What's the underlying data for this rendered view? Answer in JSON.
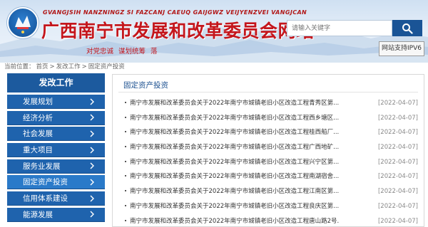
{
  "header": {
    "pinyin": "GVANGJSIH NANZNINGZ SI FAZCANJ CAEUQ GAIJGWZ VEIJYENZVEI VANGJCAN",
    "title": "广西南宁市发展和改革委员会网站",
    "slogan": "对党忠诚  谋划统筹  落",
    "search_placeholder": "请输入关键字",
    "ipv6_label": "网站支持IPV6"
  },
  "breadcrumb": {
    "prefix": "当前位置：",
    "items": [
      "首页",
      "发改工作",
      "固定资产投资"
    ],
    "separator": ">"
  },
  "sidebar": {
    "title": "发改工作",
    "items": [
      {
        "label": "发展规划"
      },
      {
        "label": "经济分析"
      },
      {
        "label": "社会发展"
      },
      {
        "label": "重大项目"
      },
      {
        "label": "服务业发展"
      },
      {
        "label": "固定资产投资"
      },
      {
        "label": "信用体系建设"
      },
      {
        "label": "能源发展"
      }
    ]
  },
  "content": {
    "title": "固定资产投资",
    "articles": [
      {
        "title": "南宁市发展和改革委员会关于2022年南宁市城镇老旧小区改造工程青秀区第...",
        "date": "[2022-04-07]"
      },
      {
        "title": "南宁市发展和改革委员会关于2022年南宁市城镇老旧小区改造工程西乡塘区...",
        "date": "[2022-04-07]"
      },
      {
        "title": "南宁市发展和改革委员会关于2022年南宁市城镇老旧小区改造工程桂西船厂...",
        "date": "[2022-04-07]"
      },
      {
        "title": "南宁市发展和改革委员会关于2022年南宁市城镇老旧小区改造工程广西地矿...",
        "date": "[2022-04-07]"
      },
      {
        "title": "南宁市发展和改革委员会关于2022年南宁市城镇老旧小区改造工程兴宁区第...",
        "date": "[2022-04-07]"
      },
      {
        "title": "南宁市发展和改革委员会关于2022年南宁市城镇老旧小区改造工程南湖宿舍...",
        "date": "[2022-04-07]"
      },
      {
        "title": "南宁市发展和改革委员会关于2022年南宁市城镇老旧小区改造工程江南区第...",
        "date": "[2022-04-07]"
      },
      {
        "title": "南宁市发展和改革委员会关于2022年南宁市城镇老旧小区改造工程良庆区第...",
        "date": "[2022-04-07]"
      },
      {
        "title": "南宁市发展和改革委员会关于2022年南宁市城镇老旧小区改造工程唐山路2号...",
        "date": "[2022-04-07]"
      }
    ]
  },
  "colors": {
    "brand_red": "#c4161c",
    "sidebar_blue": "#1f63ad",
    "sidebar_active": "#2a7ac9",
    "header_blue": "#1c5a9e"
  },
  "icons": {
    "logo": "emblem-logo",
    "search": "search-icon",
    "chevron": "chevron-right-icon"
  }
}
